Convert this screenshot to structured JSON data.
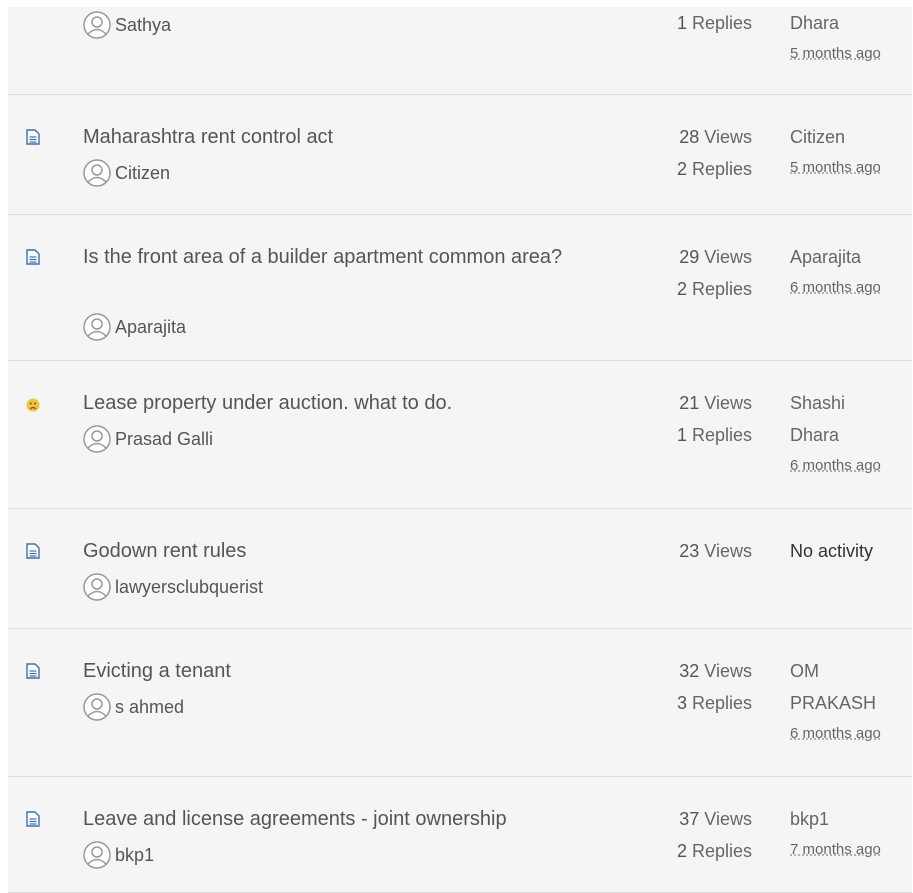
{
  "topics": [
    {
      "type": "document",
      "title": "",
      "author": "Sathya",
      "views": "",
      "replies": "1",
      "last_user": "Dhara",
      "last_time": "5 months ago"
    },
    {
      "type": "document",
      "title": "Maharashtra rent control act",
      "author": "Citizen",
      "views": "28",
      "replies": "2",
      "last_user": "Citizen",
      "last_time": "5 months ago"
    },
    {
      "type": "document",
      "title": "Is the front area of a builder apartment common area?",
      "author": "Aparajita",
      "views": "29",
      "replies": "2",
      "last_user": "Aparajita",
      "last_time": "6 months ago"
    },
    {
      "type": "sad",
      "title": "Lease property under auction. what to do.",
      "author": "Prasad Galli",
      "views": "21",
      "replies": "1",
      "last_user": "Shashi Dhara",
      "last_time": "6 months ago"
    },
    {
      "type": "document",
      "title": "Godown rent rules",
      "author": "lawyersclubquerist",
      "views": "23",
      "replies": "",
      "last_user": "",
      "last_time": "",
      "no_activity": "No activity"
    },
    {
      "type": "document",
      "title": "Evicting a tenant",
      "author": "s ahmed",
      "views": "32",
      "replies": "3",
      "last_user": "OM PRAKASH",
      "last_time": "6 months ago"
    },
    {
      "type": "document",
      "title": "Leave and license agreements - joint ownership",
      "author": "bkp1",
      "views": "37",
      "replies": "2",
      "last_user": "bkp1",
      "last_time": "7 months ago"
    }
  ],
  "labels": {
    "views": "Views",
    "replies": "Replies"
  },
  "colors": {
    "row_bg": "#f5f5f5",
    "doc_icon": "#3b6fb6",
    "sad_icon": "#f0c23b"
  }
}
